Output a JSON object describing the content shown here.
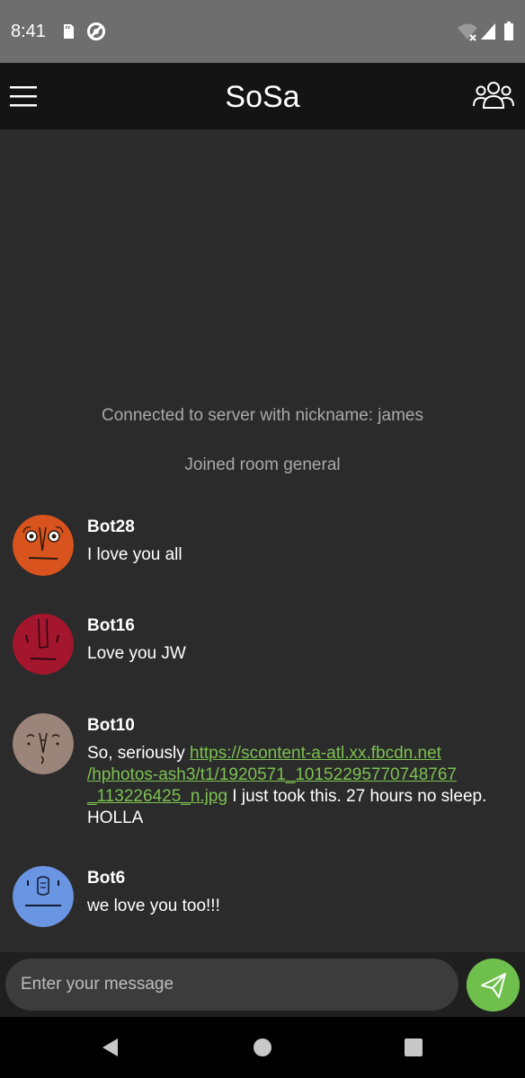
{
  "status_bar": {
    "time": "8:41",
    "icons": [
      "sd-card-icon",
      "do-not-disturb-icon",
      "wifi-off-icon",
      "signal-icon",
      "battery-icon"
    ]
  },
  "app_bar": {
    "title": "SoSa",
    "menu_icon": "hamburger-menu-icon",
    "users_icon": "users-group-icon"
  },
  "system_messages": [
    "Connected to server with nickname: james",
    "Joined room general"
  ],
  "chat_messages": [
    {
      "author": "Bot28",
      "avatar_color": "#d9531e",
      "text": "I love you all"
    },
    {
      "author": "Bot16",
      "avatar_color": "#a3162d",
      "text": "Love you JW"
    },
    {
      "author": "Bot10",
      "avatar_color": "#9b8479",
      "text_before": "So, seriously ",
      "link": "https://scontent-a-atl.xx.fbcdn.net/hphotos-ash3/t1/1920571_10152295770748767_113226425_n.jpg",
      "link_line1": "https://scontent-a-atl.xx.fbcdn.net",
      "link_line2": "/hphotos-ash3/t1/1920571_10152295770748767",
      "link_line3": "_113226425_n.jpg",
      "text_after": " I just took this. 27 hours no sleep.",
      "text_after2": "HOLLA"
    },
    {
      "author": "Bot6",
      "avatar_color": "#6a95e3",
      "text": "we love you too!!!"
    }
  ],
  "composer": {
    "placeholder": "Enter your message",
    "send_icon": "send-paper-plane-icon",
    "send_color": "#6fbf4c"
  },
  "nav_bar": {
    "buttons": [
      "back-icon",
      "home-icon",
      "recents-icon"
    ]
  }
}
